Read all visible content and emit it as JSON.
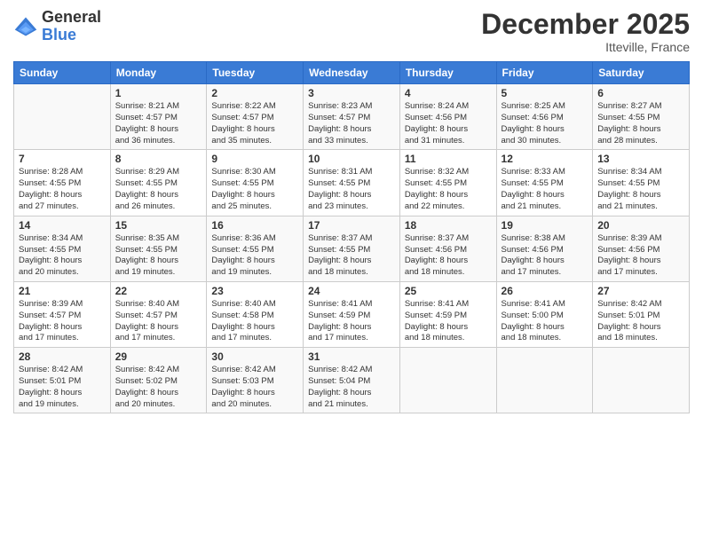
{
  "logo": {
    "general": "General",
    "blue": "Blue"
  },
  "title": "December 2025",
  "location": "Itteville, France",
  "days_header": [
    "Sunday",
    "Monday",
    "Tuesday",
    "Wednesday",
    "Thursday",
    "Friday",
    "Saturday"
  ],
  "weeks": [
    [
      {
        "day": "",
        "info": ""
      },
      {
        "day": "1",
        "info": "Sunrise: 8:21 AM\nSunset: 4:57 PM\nDaylight: 8 hours\nand 36 minutes."
      },
      {
        "day": "2",
        "info": "Sunrise: 8:22 AM\nSunset: 4:57 PM\nDaylight: 8 hours\nand 35 minutes."
      },
      {
        "day": "3",
        "info": "Sunrise: 8:23 AM\nSunset: 4:57 PM\nDaylight: 8 hours\nand 33 minutes."
      },
      {
        "day": "4",
        "info": "Sunrise: 8:24 AM\nSunset: 4:56 PM\nDaylight: 8 hours\nand 31 minutes."
      },
      {
        "day": "5",
        "info": "Sunrise: 8:25 AM\nSunset: 4:56 PM\nDaylight: 8 hours\nand 30 minutes."
      },
      {
        "day": "6",
        "info": "Sunrise: 8:27 AM\nSunset: 4:55 PM\nDaylight: 8 hours\nand 28 minutes."
      }
    ],
    [
      {
        "day": "7",
        "info": "Sunrise: 8:28 AM\nSunset: 4:55 PM\nDaylight: 8 hours\nand 27 minutes."
      },
      {
        "day": "8",
        "info": "Sunrise: 8:29 AM\nSunset: 4:55 PM\nDaylight: 8 hours\nand 26 minutes."
      },
      {
        "day": "9",
        "info": "Sunrise: 8:30 AM\nSunset: 4:55 PM\nDaylight: 8 hours\nand 25 minutes."
      },
      {
        "day": "10",
        "info": "Sunrise: 8:31 AM\nSunset: 4:55 PM\nDaylight: 8 hours\nand 23 minutes."
      },
      {
        "day": "11",
        "info": "Sunrise: 8:32 AM\nSunset: 4:55 PM\nDaylight: 8 hours\nand 22 minutes."
      },
      {
        "day": "12",
        "info": "Sunrise: 8:33 AM\nSunset: 4:55 PM\nDaylight: 8 hours\nand 21 minutes."
      },
      {
        "day": "13",
        "info": "Sunrise: 8:34 AM\nSunset: 4:55 PM\nDaylight: 8 hours\nand 21 minutes."
      }
    ],
    [
      {
        "day": "14",
        "info": "Sunrise: 8:34 AM\nSunset: 4:55 PM\nDaylight: 8 hours\nand 20 minutes."
      },
      {
        "day": "15",
        "info": "Sunrise: 8:35 AM\nSunset: 4:55 PM\nDaylight: 8 hours\nand 19 minutes."
      },
      {
        "day": "16",
        "info": "Sunrise: 8:36 AM\nSunset: 4:55 PM\nDaylight: 8 hours\nand 19 minutes."
      },
      {
        "day": "17",
        "info": "Sunrise: 8:37 AM\nSunset: 4:55 PM\nDaylight: 8 hours\nand 18 minutes."
      },
      {
        "day": "18",
        "info": "Sunrise: 8:37 AM\nSunset: 4:56 PM\nDaylight: 8 hours\nand 18 minutes."
      },
      {
        "day": "19",
        "info": "Sunrise: 8:38 AM\nSunset: 4:56 PM\nDaylight: 8 hours\nand 17 minutes."
      },
      {
        "day": "20",
        "info": "Sunrise: 8:39 AM\nSunset: 4:56 PM\nDaylight: 8 hours\nand 17 minutes."
      }
    ],
    [
      {
        "day": "21",
        "info": "Sunrise: 8:39 AM\nSunset: 4:57 PM\nDaylight: 8 hours\nand 17 minutes."
      },
      {
        "day": "22",
        "info": "Sunrise: 8:40 AM\nSunset: 4:57 PM\nDaylight: 8 hours\nand 17 minutes."
      },
      {
        "day": "23",
        "info": "Sunrise: 8:40 AM\nSunset: 4:58 PM\nDaylight: 8 hours\nand 17 minutes."
      },
      {
        "day": "24",
        "info": "Sunrise: 8:41 AM\nSunset: 4:59 PM\nDaylight: 8 hours\nand 17 minutes."
      },
      {
        "day": "25",
        "info": "Sunrise: 8:41 AM\nSunset: 4:59 PM\nDaylight: 8 hours\nand 18 minutes."
      },
      {
        "day": "26",
        "info": "Sunrise: 8:41 AM\nSunset: 5:00 PM\nDaylight: 8 hours\nand 18 minutes."
      },
      {
        "day": "27",
        "info": "Sunrise: 8:42 AM\nSunset: 5:01 PM\nDaylight: 8 hours\nand 18 minutes."
      }
    ],
    [
      {
        "day": "28",
        "info": "Sunrise: 8:42 AM\nSunset: 5:01 PM\nDaylight: 8 hours\nand 19 minutes."
      },
      {
        "day": "29",
        "info": "Sunrise: 8:42 AM\nSunset: 5:02 PM\nDaylight: 8 hours\nand 20 minutes."
      },
      {
        "day": "30",
        "info": "Sunrise: 8:42 AM\nSunset: 5:03 PM\nDaylight: 8 hours\nand 20 minutes."
      },
      {
        "day": "31",
        "info": "Sunrise: 8:42 AM\nSunset: 5:04 PM\nDaylight: 8 hours\nand 21 minutes."
      },
      {
        "day": "",
        "info": ""
      },
      {
        "day": "",
        "info": ""
      },
      {
        "day": "",
        "info": ""
      }
    ]
  ]
}
